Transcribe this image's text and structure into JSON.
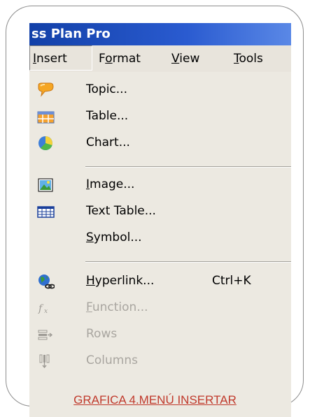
{
  "window": {
    "title": "ss Plan Pro"
  },
  "menubar": {
    "items": [
      "Insert",
      "Format",
      "View",
      "Tools"
    ]
  },
  "menu": {
    "items": [
      {
        "label": "Topic...",
        "icon": "topic-icon"
      },
      {
        "label": "Table...",
        "icon": "table-icon"
      },
      {
        "label": "Chart...",
        "icon": "chart-icon"
      },
      {
        "label": "Image...",
        "icon": "image-icon"
      },
      {
        "label": "Text Table...",
        "icon": "text-table-icon"
      },
      {
        "label": "Symbol...",
        "icon": ""
      },
      {
        "label": "Hyperlink...",
        "shortcut": "Ctrl+K",
        "icon": "hyperlink-icon"
      },
      {
        "label": "Function...",
        "icon": "function-icon",
        "disabled": true
      },
      {
        "label": "Rows",
        "icon": "rows-icon",
        "disabled": true
      },
      {
        "label": "Columns",
        "icon": "columns-icon",
        "disabled": true
      }
    ]
  },
  "caption": "GRAFICA 4.MENÚ INSERTAR",
  "colors": {
    "titlebar": "#2a5bd0",
    "menu_bg": "#ece9e1",
    "caption": "#c0392b"
  }
}
